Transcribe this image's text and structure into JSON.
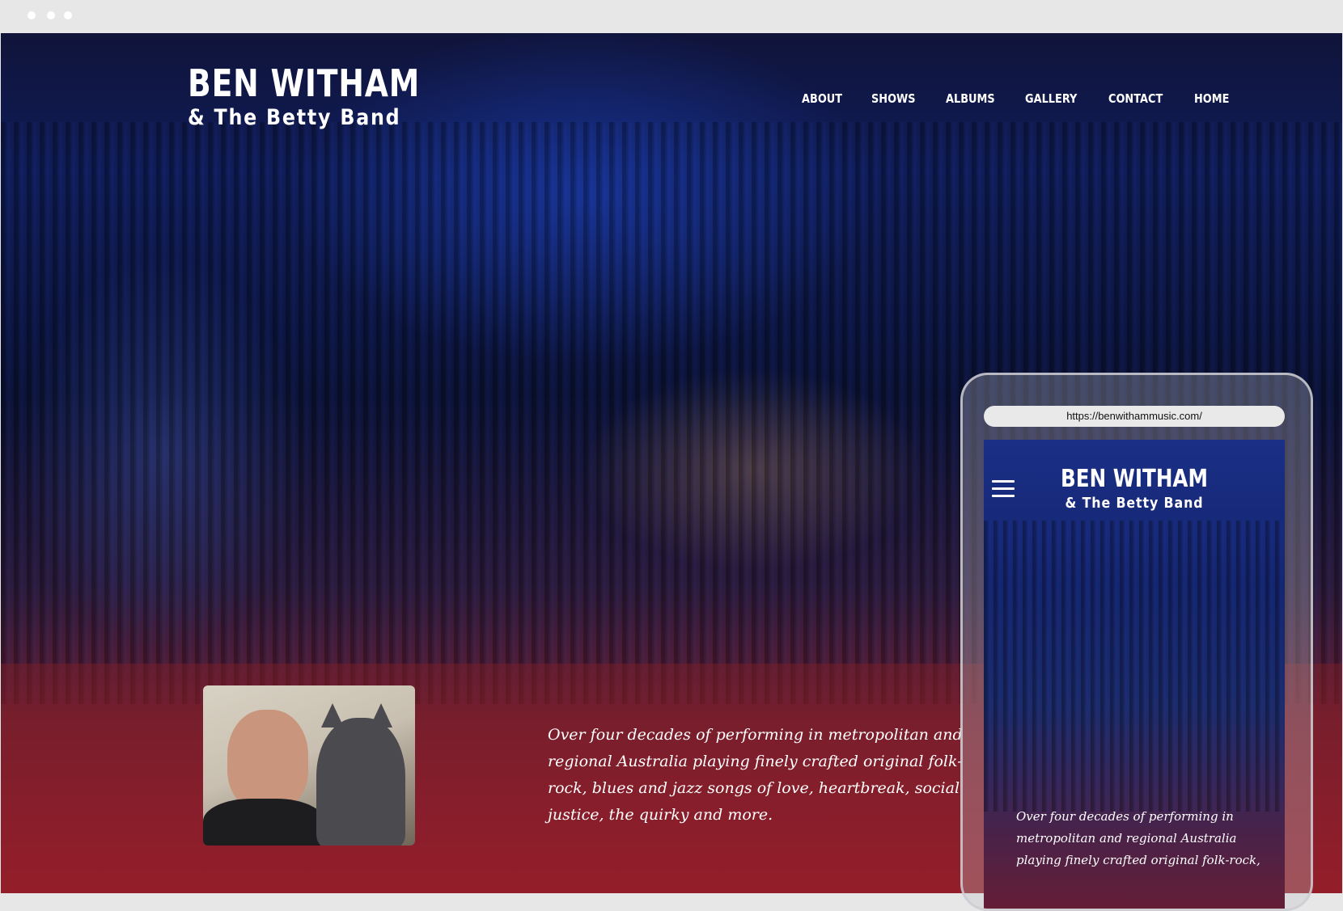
{
  "browser": {
    "url": "https://benwithammusic.com/"
  },
  "site": {
    "logo_line1": "BEN WITHAM",
    "logo_line2": "& The Betty Band"
  },
  "nav": {
    "items": [
      "ABOUT",
      "SHOWS",
      "ALBUMS",
      "GALLERY",
      "CONTACT",
      "HOME"
    ]
  },
  "hero": {
    "tagline": "Over four decades of performing in metropolitan and regional Australia playing finely crafted original folk-rock, blues and jazz songs of love, heartbreak, social justice, the quirky and more."
  },
  "mobile_preview": {
    "tagline_visible": "Over four decades of performing in metropolitan and regional Australia playing finely crafted original folk-rock,",
    "menu_icon": "hamburger-menu-icon"
  },
  "colors": {
    "chrome": "#e7e7e8",
    "hero_blue": "#0f1c58",
    "stage_red": "#8c2030",
    "text": "#ffffff"
  }
}
